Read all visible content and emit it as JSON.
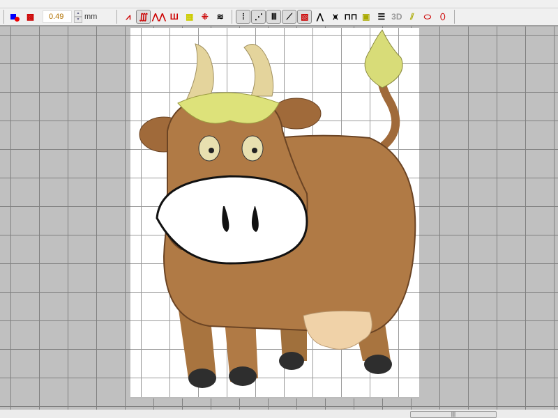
{
  "toolbar_top": {
    "icons": [
      "cut-icon",
      "copy-icon",
      "paste-icon",
      "undo-icon",
      "redo-icon",
      "select-icon",
      "import-icon",
      "fill-icon",
      "satin-icon",
      "shape-icon",
      "points-icon",
      "needle-icon",
      "center-icon",
      "grid-icon",
      "folder-icon",
      "landscape-icon",
      "palette-icon",
      "plant-icon",
      "disk-icon",
      "colors-icon",
      "color-blocks-icon",
      "stitch-list-icon",
      "document-icon"
    ]
  },
  "toolbar": {
    "spacing_value": "0.49",
    "unit": "mm",
    "stitch_types": [
      "zigzag",
      "satin",
      "triple-zigzag",
      "e-stitch",
      "fill",
      "cross",
      "wave",
      "grid-fill",
      "angle-lines",
      "fan",
      "radial",
      "gradient",
      "triangle",
      "jagged",
      "meander",
      "spiral",
      "lines"
    ],
    "label_3d": "3D",
    "extra_icons": [
      "motif",
      "outline",
      "contour"
    ]
  },
  "scrollbar": {
    "thumb_label": "|||"
  },
  "colors": {
    "canvas": "#c0c0c0",
    "body": "#b07a45",
    "horn": "#e4d49c",
    "tuft": "#dde27a",
    "udder": "#f0d2a8",
    "hoof": "#2e2e2e"
  }
}
